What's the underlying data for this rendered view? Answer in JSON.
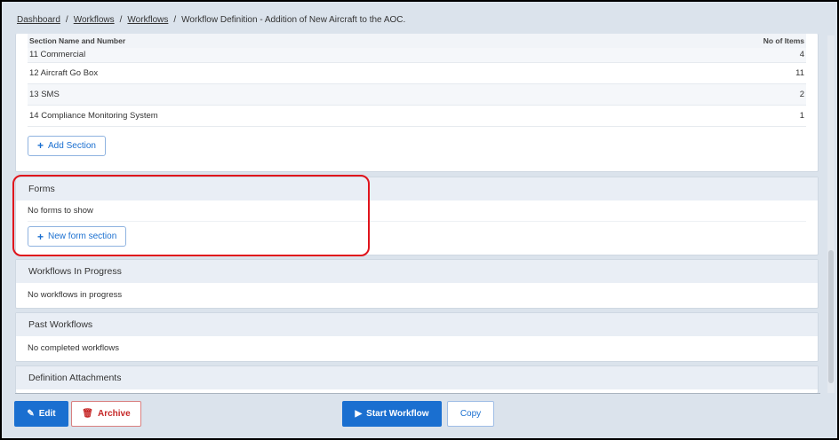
{
  "breadcrumb": {
    "items": [
      "Dashboard",
      "Workflows",
      "Workflows"
    ],
    "current": "Workflow Definition - Addition of New Aircraft to the AOC.",
    "sep": "/"
  },
  "sections": {
    "col_name": "Section Name and Number",
    "col_items": "No of Items",
    "rows": [
      {
        "name": "11 Commercial",
        "items": "4"
      },
      {
        "name": "12 Aircraft Go Box",
        "items": "11"
      },
      {
        "name": "13 SMS",
        "items": "2"
      },
      {
        "name": "14 Compliance Monitoring System",
        "items": "1"
      }
    ],
    "add_label": "Add Section"
  },
  "forms": {
    "title": "Forms",
    "empty": "No forms to show",
    "new_label": "New form section"
  },
  "in_progress": {
    "title": "Workflows In Progress",
    "empty": "No workflows in progress"
  },
  "past": {
    "title": "Past Workflows",
    "empty": "No completed workflows"
  },
  "attachments": {
    "title": "Definition Attachments"
  },
  "footer": {
    "edit": "Edit",
    "archive": "Archive",
    "start": "Start Workflow",
    "copy": "Copy"
  },
  "colors": {
    "primary": "#1a6fd0",
    "danger": "#c62828",
    "highlight": "#e0141c"
  }
}
